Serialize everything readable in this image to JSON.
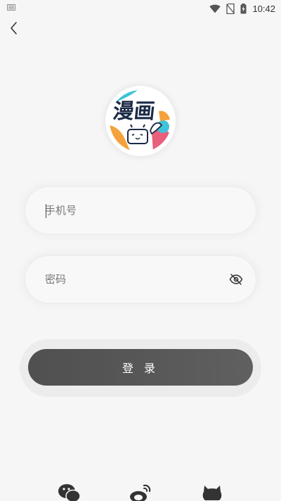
{
  "status_bar": {
    "time": "10:42",
    "icons": [
      "keyboard-icon",
      "wifi-icon",
      "no-sim-icon",
      "battery-charging-icon"
    ]
  },
  "header": {
    "back_icon": "chevron-left-icon"
  },
  "logo": {
    "title": "漫画",
    "icon": "bilibili-comics-logo"
  },
  "form": {
    "phone_placeholder": "手机号",
    "phone_value": "",
    "password_placeholder": "密码",
    "password_value": "",
    "visibility_icon": "eye-off-icon"
  },
  "actions": {
    "login_label": "登 录"
  },
  "social": {
    "items": [
      "wechat-icon",
      "weibo-icon",
      "github-icon"
    ]
  },
  "colors": {
    "background": "#f6f6f6",
    "button": "#555555",
    "button_text": "#ffffff",
    "logo_accent_cyan": "#3fc3d8",
    "logo_accent_orange": "#f4a23b",
    "logo_accent_pink": "#e8607c"
  }
}
